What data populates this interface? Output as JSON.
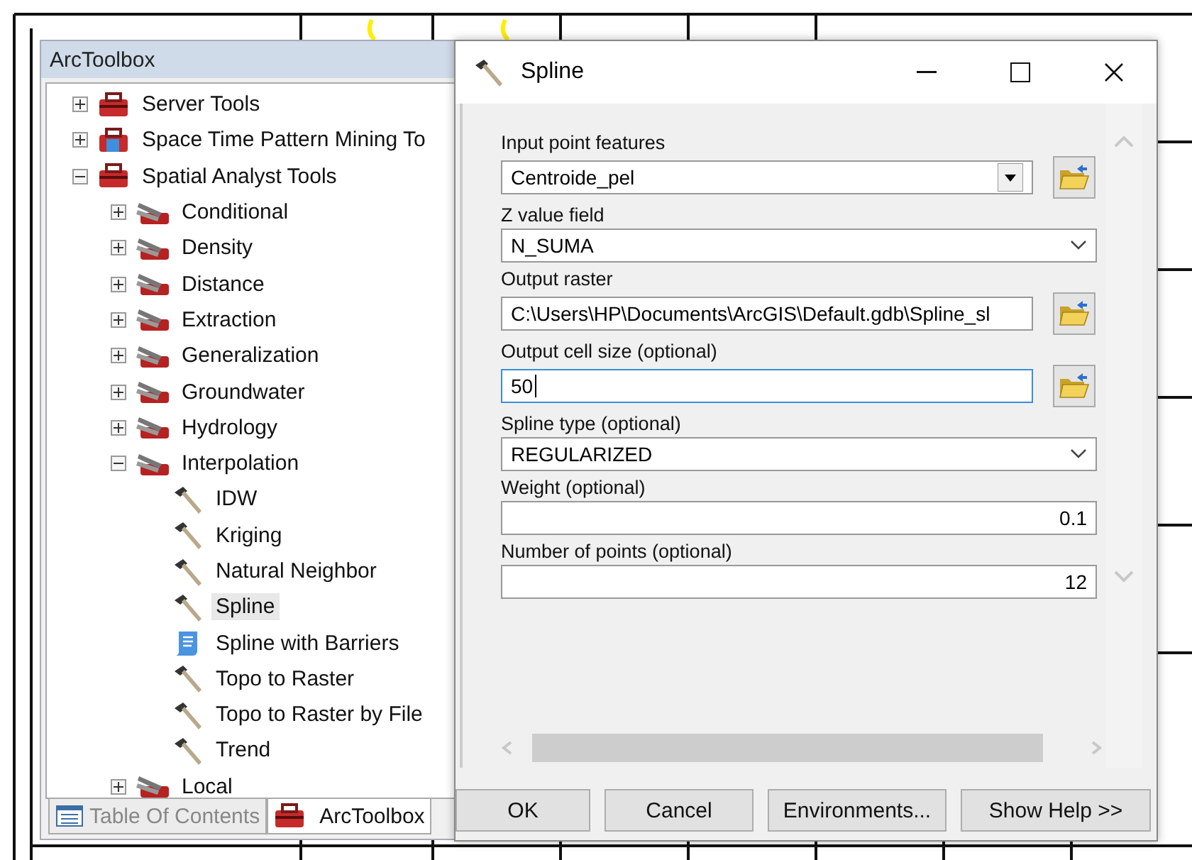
{
  "toolbox": {
    "title": "ArcToolbox",
    "tree": [
      {
        "label": "Server Tools",
        "kind": "toolbox",
        "expanded": false,
        "selected": false
      },
      {
        "label": "Space Time Pattern Mining To",
        "kind": "scripted",
        "expanded": false,
        "selected": false
      },
      {
        "label": "Spatial Analyst Tools",
        "kind": "toolbox",
        "expanded": true,
        "selected": false,
        "children": [
          {
            "label": "Conditional",
            "kind": "toolset",
            "expanded": false,
            "selected": false
          },
          {
            "label": "Density",
            "kind": "toolset",
            "expanded": false,
            "selected": false
          },
          {
            "label": "Distance",
            "kind": "toolset",
            "expanded": false,
            "selected": false
          },
          {
            "label": "Extraction",
            "kind": "toolset",
            "expanded": false,
            "selected": false
          },
          {
            "label": "Generalization",
            "kind": "toolset",
            "expanded": false,
            "selected": false
          },
          {
            "label": "Groundwater",
            "kind": "toolset",
            "expanded": false,
            "selected": false
          },
          {
            "label": "Hydrology",
            "kind": "toolset",
            "expanded": false,
            "selected": false
          },
          {
            "label": "Interpolation",
            "kind": "toolset",
            "expanded": true,
            "selected": false,
            "children": [
              {
                "label": "IDW",
                "kind": "tool",
                "selected": false
              },
              {
                "label": "Kriging",
                "kind": "tool",
                "selected": false
              },
              {
                "label": "Natural Neighbor",
                "kind": "tool",
                "selected": false
              },
              {
                "label": "Spline",
                "kind": "tool",
                "selected": true
              },
              {
                "label": "Spline with Barriers",
                "kind": "script",
                "selected": false
              },
              {
                "label": "Topo to Raster",
                "kind": "tool",
                "selected": false
              },
              {
                "label": "Topo to Raster by File",
                "kind": "tool",
                "selected": false
              },
              {
                "label": "Trend",
                "kind": "tool",
                "selected": false
              }
            ]
          },
          {
            "label": "Local",
            "kind": "toolset",
            "expanded": false,
            "selected": false
          }
        ]
      }
    ],
    "tabs": [
      {
        "label": "Table Of Contents",
        "kind": "list",
        "selected": false
      },
      {
        "label": "ArcToolbox",
        "kind": "toolbox",
        "selected": true
      }
    ]
  },
  "dialog": {
    "title": "Spline",
    "fields": [
      {
        "label": "Input point features",
        "kind": "combo",
        "value": "Centroide_pel",
        "browse": true,
        "focused": false
      },
      {
        "label": "Z value field",
        "kind": "dropdown",
        "value": "N_SUMA",
        "browse": false,
        "focused": false
      },
      {
        "label": "Output raster",
        "kind": "text",
        "value": "C:\\Users\\HP\\Documents\\ArcGIS\\Default.gdb\\Spline_sl",
        "browse": true,
        "focused": false
      },
      {
        "label": "Output cell size (optional)",
        "kind": "text",
        "value": "50",
        "browse": true,
        "focused": true
      },
      {
        "label": "Spline type (optional)",
        "kind": "dropdown",
        "value": "REGULARIZED",
        "browse": false,
        "focused": false
      },
      {
        "label": "Weight (optional)",
        "kind": "number",
        "value": "0.1",
        "browse": false,
        "focused": false
      },
      {
        "label": "Number of points (optional)",
        "kind": "number",
        "value": "12",
        "browse": false,
        "focused": false
      }
    ],
    "buttons": [
      "OK",
      "Cancel",
      "Environments...",
      "Show Help >>"
    ]
  }
}
